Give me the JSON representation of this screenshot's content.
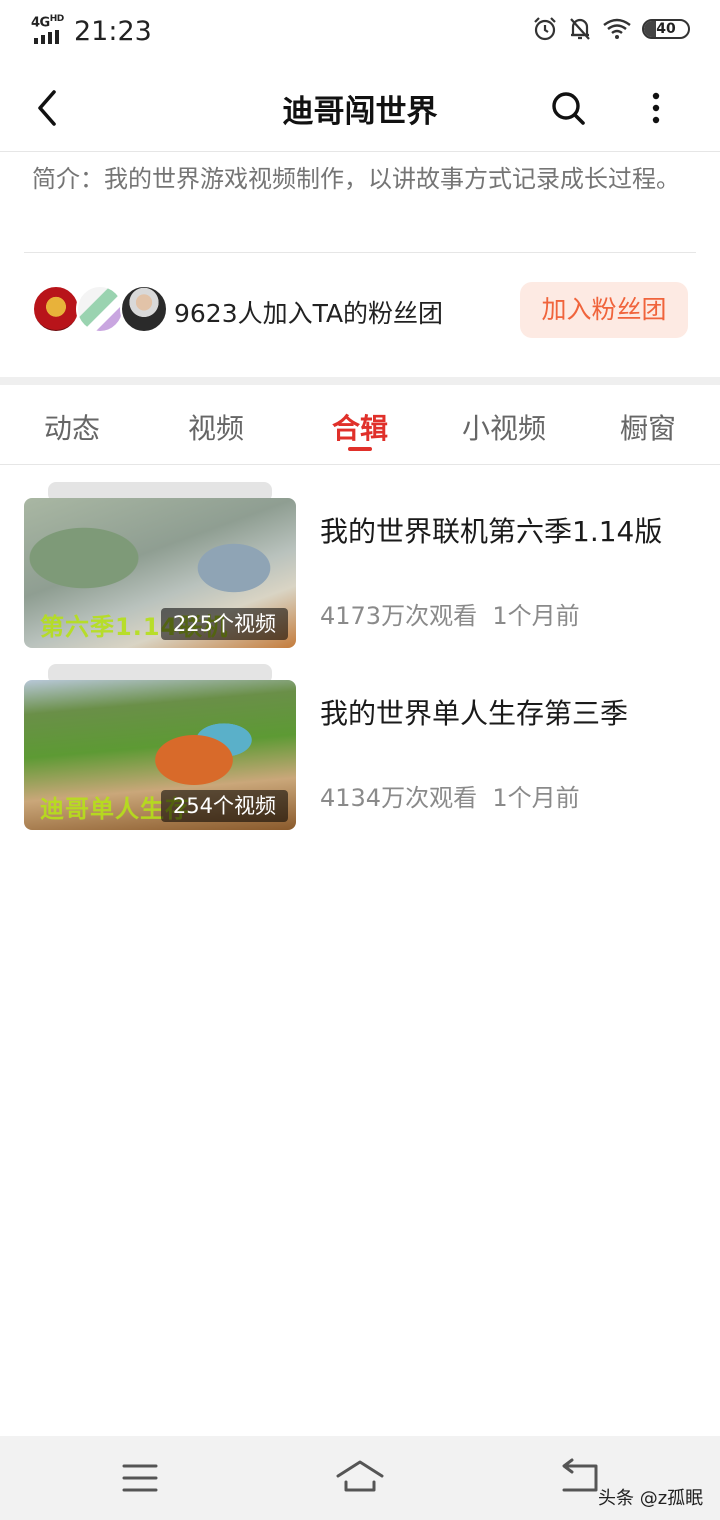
{
  "status_bar": {
    "network": "4G",
    "network_sup": "HD",
    "time": "21:23",
    "battery": "40",
    "icons": [
      "alarm-icon",
      "mute-bell-icon",
      "wifi-icon",
      "battery-icon"
    ]
  },
  "header": {
    "title": "迪哥闯世界",
    "icons": [
      "back-icon",
      "search-icon",
      "more-icon"
    ]
  },
  "intro": {
    "text": "简介：我的世界游戏视频制作，以讲故事方式记录成长过程。"
  },
  "fans": {
    "text": "9623人加入TA的粉丝团",
    "join_label": "加入粉丝团"
  },
  "tabs": [
    {
      "label": "动态",
      "active": false
    },
    {
      "label": "视频",
      "active": false
    },
    {
      "label": "合辑",
      "active": true
    },
    {
      "label": "小视频",
      "active": false
    },
    {
      "label": "橱窗",
      "active": false
    }
  ],
  "collections": [
    {
      "title": "我的世界联机第六季1.14版",
      "count": "225个视频",
      "views": "4173万次观看",
      "time": "1个月前",
      "thumb_caption": "第六季1.14联机"
    },
    {
      "title": "我的世界单人生存第三季",
      "count": "254个视频",
      "views": "4134万次观看",
      "time": "1个月前",
      "thumb_caption": "迪哥单人生存"
    }
  ],
  "nav": {
    "icons": [
      "menu-icon",
      "home-icon",
      "return-icon"
    ],
    "watermark": "头条 @z孤眠"
  },
  "colors": {
    "accent": "#e0302a",
    "join_bg": "#fdeae3",
    "join_text": "#f0643c"
  }
}
